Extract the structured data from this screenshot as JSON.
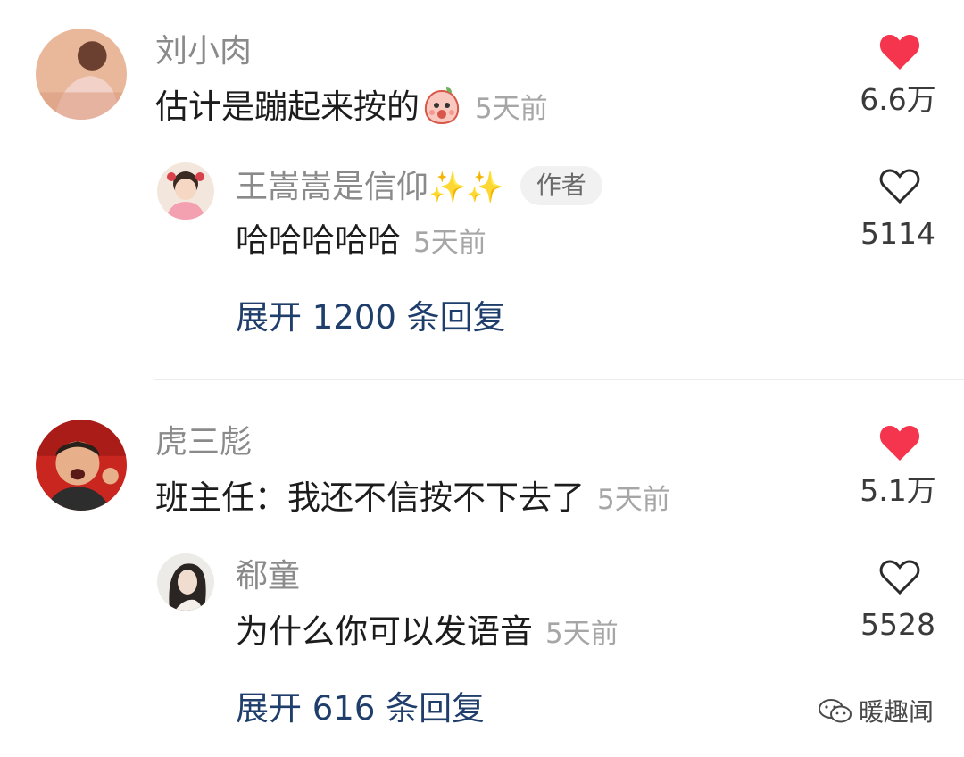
{
  "comments": [
    {
      "username": "刘小肉",
      "text": "估计是蹦起来按的",
      "emoji": "peach-face-emoji",
      "time": "5天前",
      "likes": "6.6万",
      "liked": true,
      "reply": {
        "username": "王嵩嵩是信仰",
        "sparkles": "✨✨",
        "badge": "作者",
        "text": "哈哈哈哈哈",
        "time": "5天前",
        "likes": "5114",
        "liked": false
      },
      "expand_label": "展开 1200 条回复"
    },
    {
      "username": "虎三彪",
      "text": "班主任：我还不信按不下去了",
      "time": "5天前",
      "likes": "5.1万",
      "liked": true,
      "reply": {
        "username": "郗童",
        "text": "为什么你可以发语音",
        "time": "5天前",
        "likes": "5528",
        "liked": false
      },
      "expand_label": "展开 616 条回复"
    }
  ],
  "watermark": "暖趣闻",
  "colors": {
    "heart_red": "#f5354d",
    "link_blue": "#1f3e6b",
    "username_gray": "#8a8a8a",
    "time_gray": "#a6a6a6"
  }
}
